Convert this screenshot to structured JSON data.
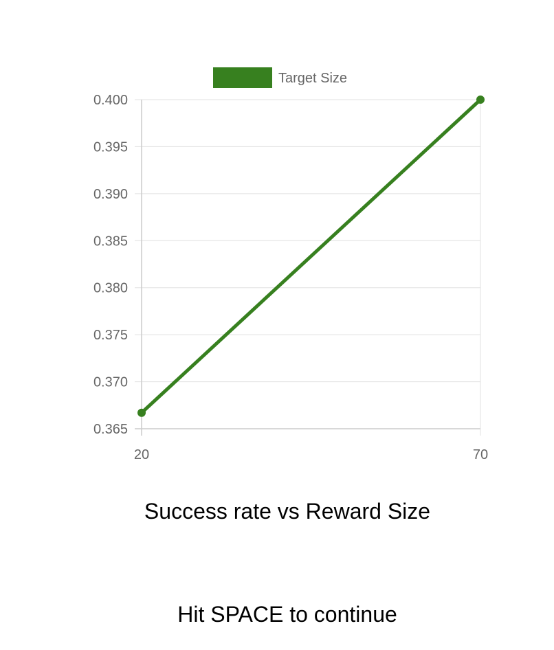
{
  "chart_data": {
    "type": "line",
    "x": [
      20,
      70
    ],
    "series": [
      {
        "name": "Target Size",
        "values": [
          0.3667,
          0.4
        ],
        "color": "#37801f"
      }
    ],
    "y_ticks": [
      "0.400",
      "0.395",
      "0.390",
      "0.385",
      "0.380",
      "0.375",
      "0.370",
      "0.365"
    ],
    "x_ticks": [
      "20",
      "70"
    ],
    "ylim": [
      0.365,
      0.4
    ],
    "xlim": [
      20,
      70
    ],
    "grid": true,
    "legend": "top-center"
  },
  "caption": "Success rate vs Reward Size",
  "instruction": "Hit SPACE to continue"
}
